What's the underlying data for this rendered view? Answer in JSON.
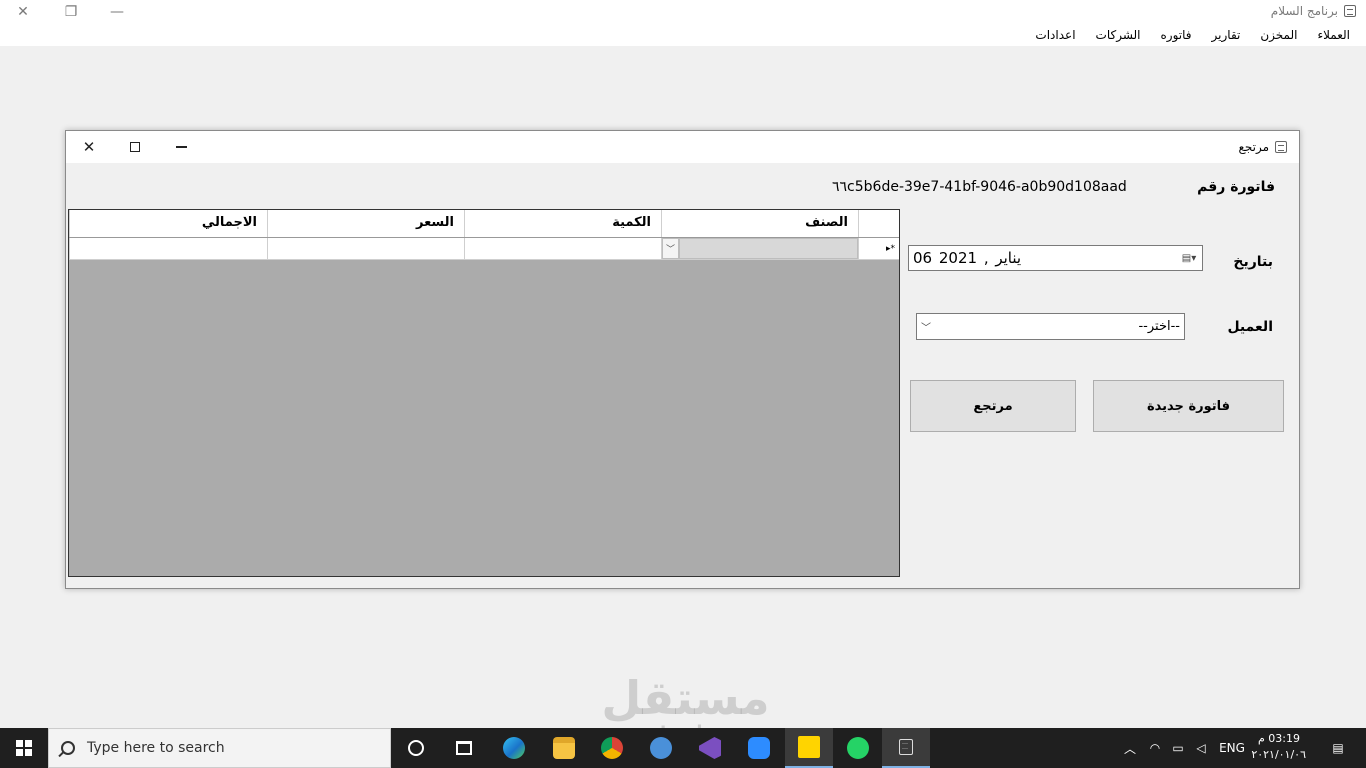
{
  "app": {
    "title": "برنامج السلام",
    "menu": [
      "العملاء",
      "المخزن",
      "تقارير",
      "فاتوره",
      "الشركات",
      "اعدادات"
    ]
  },
  "window": {
    "title": "مرتجع",
    "invoice_label": "فاتورة رقم",
    "invoice_number": "٦٦c5b6de-39e7-41bf-9046-a0b90d108aad",
    "date_label": "بتاريخ",
    "date_value": "06   يناير  , 2021",
    "customer_label": "العميل",
    "customer_value": "--اختر--",
    "new_invoice_button": "فاتورة جديدة",
    "return_button": "مرتجع",
    "grid": {
      "columns": [
        "الصنف",
        "الكمية",
        "السعر",
        "الاجمالي"
      ],
      "new_row_marker": "▸*"
    }
  },
  "taskbar": {
    "search_placeholder": "Type here to search",
    "language": "ENG",
    "time": "03:19 م",
    "date": "٢٠٢١/٠١/٠٦"
  },
  "watermark": {
    "arabic": "مستقل",
    "latin": "mostaql.com"
  },
  "colors": {
    "grid_background": "#ababab",
    "taskbar": "#1f1f1f",
    "window_bg": "#f0f0f0"
  }
}
